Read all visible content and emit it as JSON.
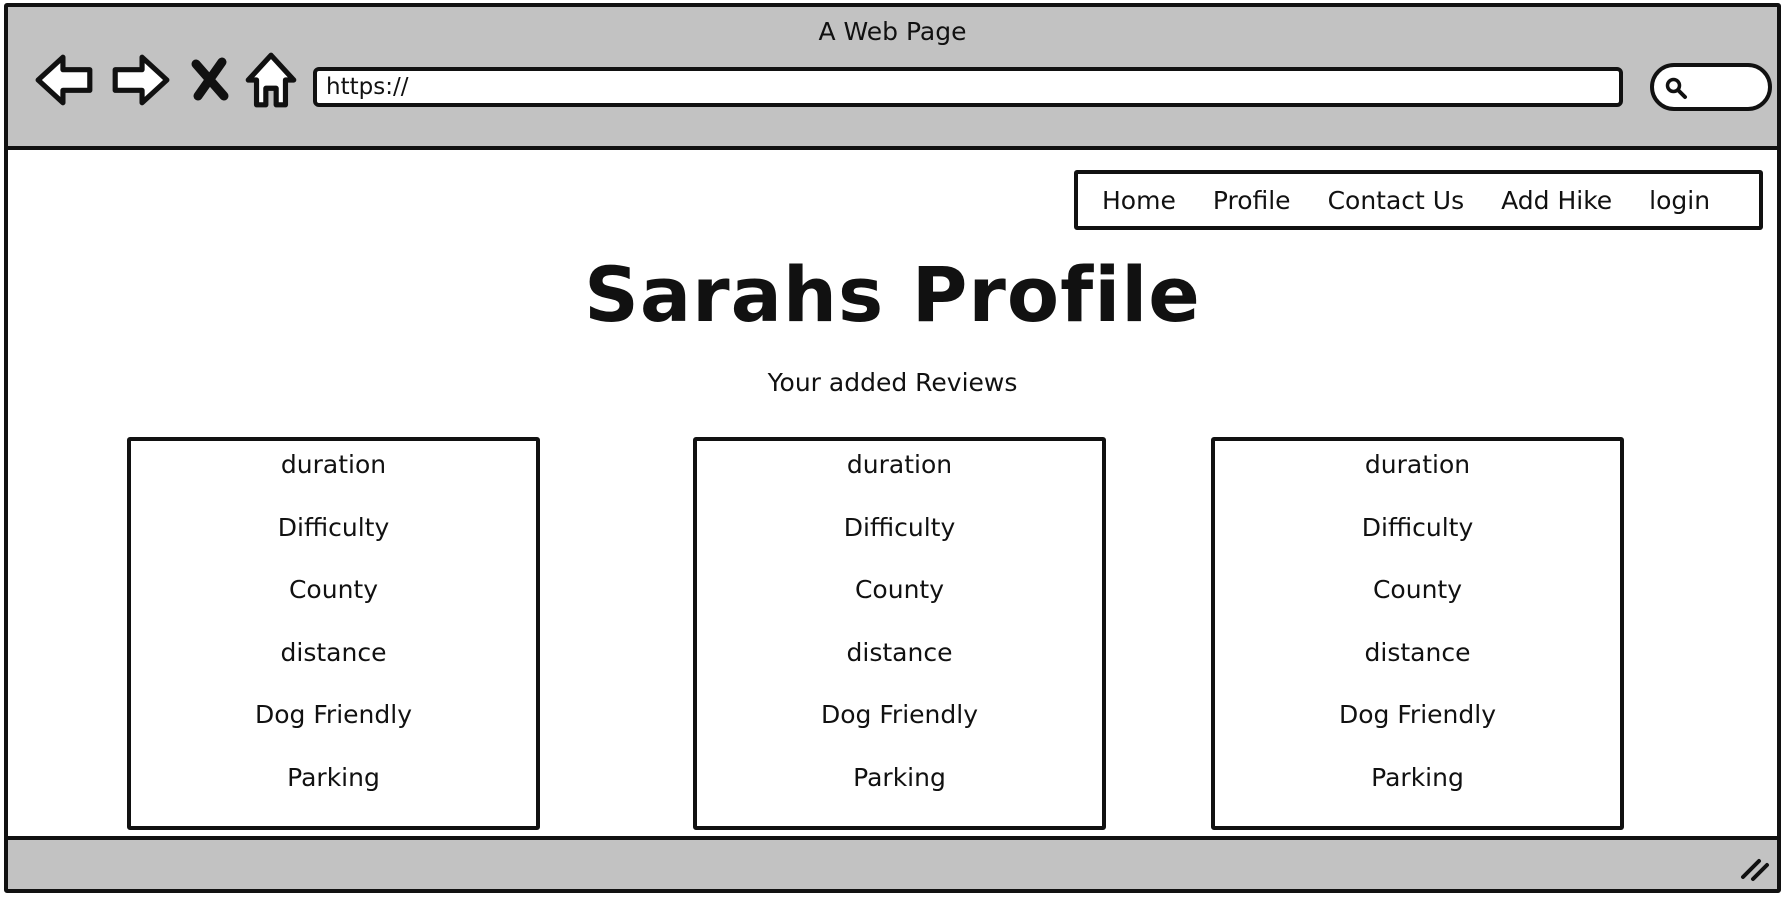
{
  "window": {
    "title": "A Web Page"
  },
  "toolbar": {
    "url_value": "https://",
    "icons": [
      "back-arrow-icon",
      "forward-arrow-icon",
      "stop-x-icon",
      "home-icon",
      "search-icon"
    ]
  },
  "nav": {
    "items": [
      {
        "label": "Home"
      },
      {
        "label": "Profile"
      },
      {
        "label": "Contact Us"
      },
      {
        "label": "Add Hike"
      },
      {
        "label": "login"
      }
    ]
  },
  "page": {
    "title": "Sarahs Profile",
    "subtitle": "Your added Reviews"
  },
  "reviews": [
    {
      "fields": [
        "duration",
        "Difficulty",
        "County",
        "distance",
        "Dog Friendly",
        "Parking"
      ]
    },
    {
      "fields": [
        "duration",
        "Difficulty",
        "County",
        "distance",
        "Dog Friendly",
        "Parking"
      ]
    },
    {
      "fields": [
        "duration",
        "Difficulty",
        "County",
        "distance",
        "Dog Friendly",
        "Parking"
      ]
    }
  ],
  "colors": {
    "chrome": "#c2c2c2",
    "stroke": "#111111",
    "background": "#ffffff"
  }
}
